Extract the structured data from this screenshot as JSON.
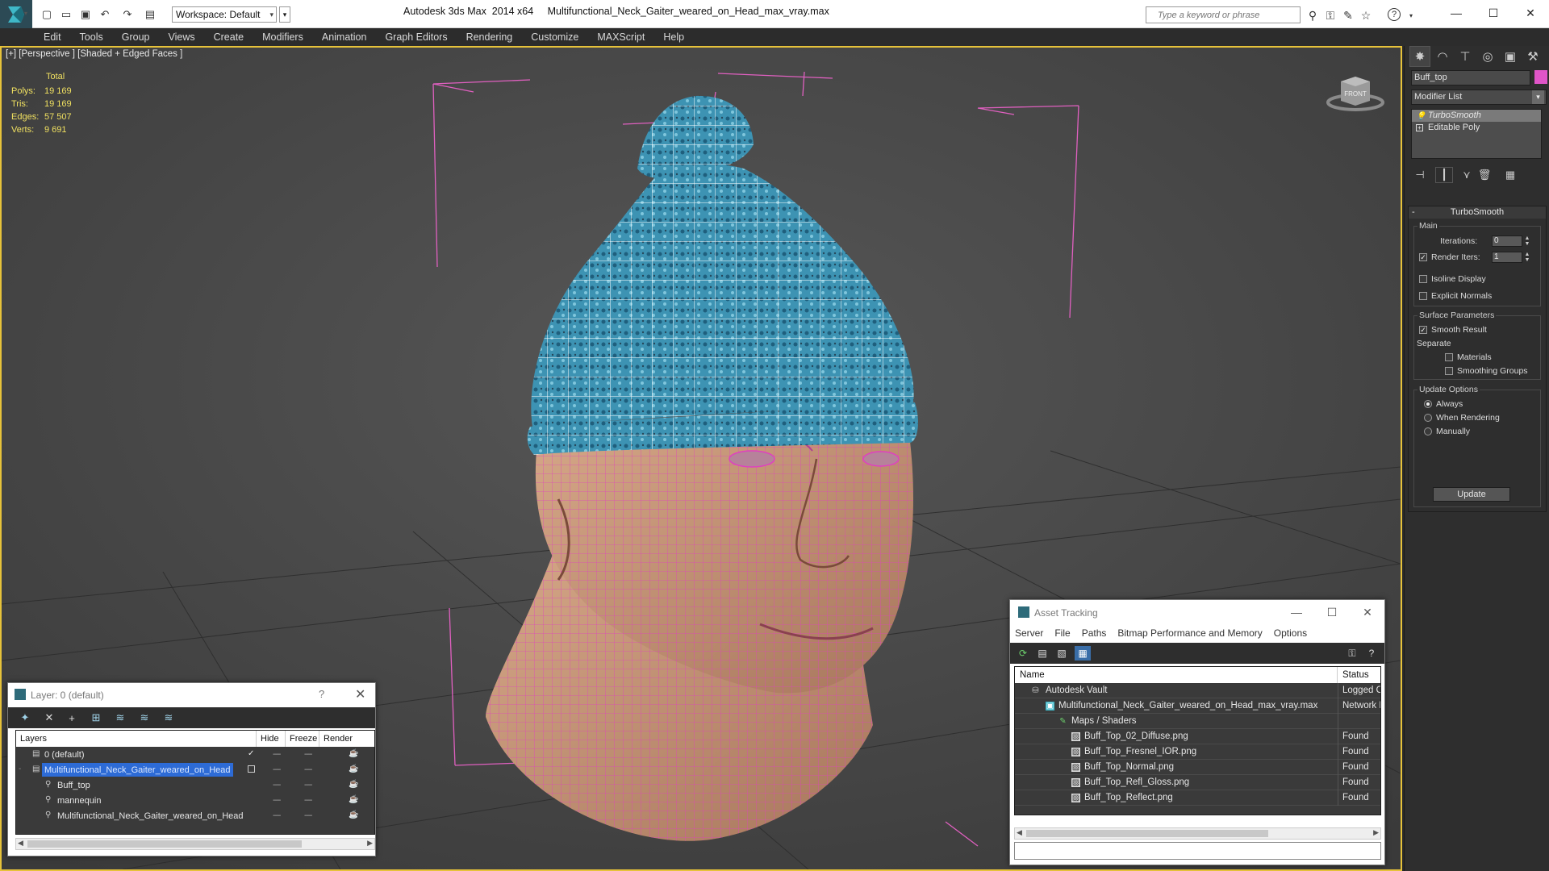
{
  "window": {
    "title": "Autodesk 3ds Max  2014 x64     Multifunctional_Neck_Gaiter_weared_on_Head_max_vray.max",
    "workspace": "Workspace: Default",
    "search_placeholder": "Type a keyword or phrase"
  },
  "menu": [
    "Edit",
    "Tools",
    "Group",
    "Views",
    "Create",
    "Modifiers",
    "Animation",
    "Graph Editors",
    "Rendering",
    "Customize",
    "MAXScript",
    "Help"
  ],
  "viewport": {
    "label": "[+] [Perspective ] [Shaded + Edged Faces ]",
    "stats": {
      "header": "Total",
      "rows": [
        {
          "key": "Polys:",
          "value": "19 169"
        },
        {
          "key": "Tris:",
          "value": "19 169"
        },
        {
          "key": "Edges:",
          "value": "57 507"
        },
        {
          "key": "Verts:",
          "value": "9 691"
        }
      ]
    },
    "viewcube_label": "FRONT"
  },
  "command_panel": {
    "object_name": "Buff_top",
    "object_color": "#e055c8",
    "modifier_list": "Modifier List",
    "stack": [
      {
        "label": "TurboSmooth",
        "selected": true
      },
      {
        "label": "Editable Poly",
        "selected": false
      }
    ],
    "rollout": {
      "title": "TurboSmooth",
      "main_group": "Main",
      "iterations_label": "Iterations:",
      "iterations_value": "0",
      "render_iters_label": "Render Iters:",
      "render_iters_value": "1",
      "render_iters_checked": true,
      "isoline_label": "Isoline Display",
      "explicit_normals_label": "Explicit Normals",
      "surface_group": "Surface Parameters",
      "smooth_result_label": "Smooth Result",
      "separate_label": "Separate",
      "materials_label": "Materials",
      "smoothing_groups_label": "Smoothing Groups",
      "update_group": "Update Options",
      "always_label": "Always",
      "when_rendering_label": "When Rendering",
      "manually_label": "Manually",
      "update_button": "Update"
    }
  },
  "layer_dialog": {
    "title": "Layer: 0 (default)",
    "help": "?",
    "columns": [
      "Layers",
      "Hide",
      "Freeze",
      "Render"
    ],
    "rows": [
      {
        "name": "0 (default)",
        "indent": 1,
        "selected": false
      },
      {
        "name": "Multifunctional_Neck_Gaiter_weared_on_Head",
        "indent": 1,
        "selected": true
      },
      {
        "name": "Buff_top",
        "indent": 2,
        "selected": false
      },
      {
        "name": "mannequin",
        "indent": 2,
        "selected": false
      },
      {
        "name": "Multifunctional_Neck_Gaiter_weared_on_Head",
        "indent": 2,
        "selected": false
      }
    ]
  },
  "asset_dialog": {
    "title": "Asset Tracking",
    "menu": [
      "Server",
      "File",
      "Paths",
      "Bitmap Performance and Memory",
      "Options"
    ],
    "columns": [
      "Name",
      "Status"
    ],
    "rows": [
      {
        "name": "Autodesk Vault",
        "status": "Logged Ou",
        "indent": 1
      },
      {
        "name": "Multifunctional_Neck_Gaiter_weared_on_Head_max_vray.max",
        "status": "Network P",
        "indent": 2
      },
      {
        "name": "Maps / Shaders",
        "status": "",
        "indent": 3
      },
      {
        "name": "Buff_Top_02_Diffuse.png",
        "status": "Found",
        "indent": 4
      },
      {
        "name": "Buff_Top_Fresnel_IOR.png",
        "status": "Found",
        "indent": 4
      },
      {
        "name": "Buff_Top_Normal.png",
        "status": "Found",
        "indent": 4
      },
      {
        "name": "Buff_Top_Refl_Gloss.png",
        "status": "Found",
        "indent": 4
      },
      {
        "name": "Buff_Top_Reflect.png",
        "status": "Found",
        "indent": 4
      }
    ]
  },
  "colors": {
    "viewport_border": "#e6c23a",
    "stats_text": "#f0e060",
    "wire_pink": "#e040c0",
    "hat_blue": "#3a8eae",
    "skin": "#c99a7c",
    "selection_blue": "#2d6bd6"
  }
}
